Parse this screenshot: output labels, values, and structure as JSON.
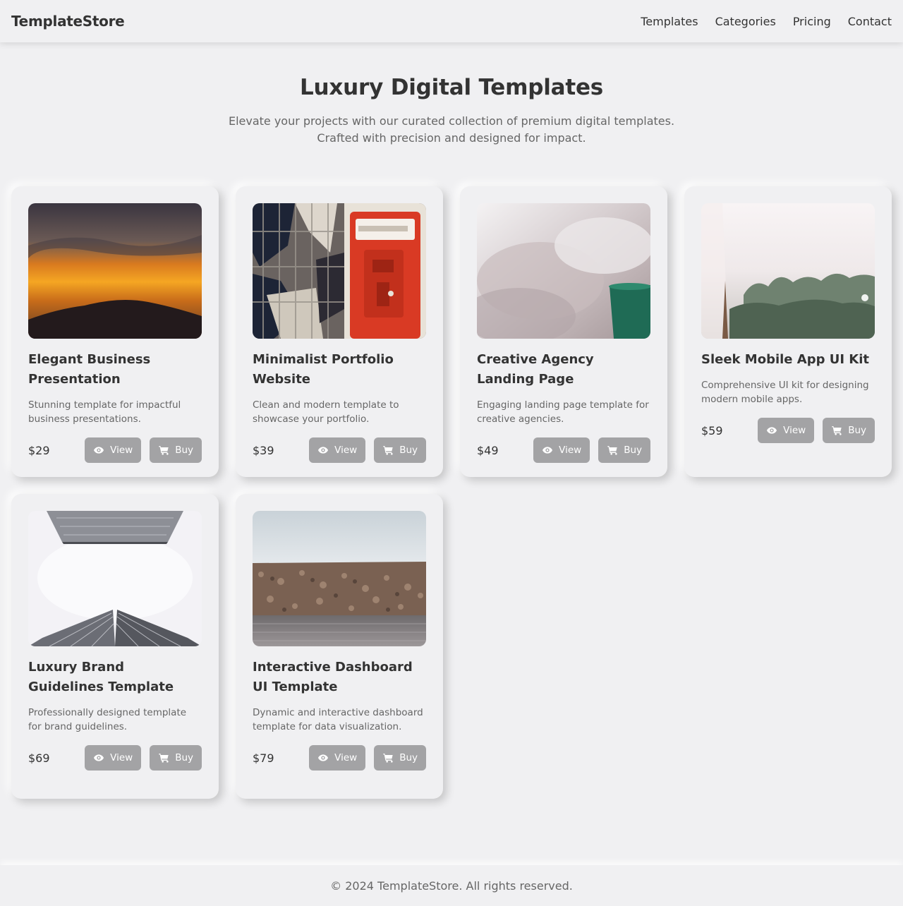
{
  "nav": {
    "brand": "TemplateStore",
    "links": [
      "Templates",
      "Categories",
      "Pricing",
      "Contact"
    ]
  },
  "hero": {
    "title": "Luxury Digital Templates",
    "subtitle_line1": "Elevate your projects with our curated collection of premium digital templates.",
    "subtitle_line2": "Crafted with precision and designed for impact."
  },
  "buttons": {
    "view": "View",
    "buy": "Buy"
  },
  "icons": {
    "view": "eye-icon",
    "buy": "cart-icon"
  },
  "templates": [
    {
      "title": "Elegant Business Presentation",
      "description": "Stunning template for impactful business presentations.",
      "price": "$29",
      "image": "sunset-mountain-silhouette"
    },
    {
      "title": "Minimalist Portfolio Website",
      "description": "Clean and modern template to showcase your portfolio.",
      "price": "$39",
      "image": "red-alarm-box"
    },
    {
      "title": "Creative Agency Landing Page",
      "description": "Engaging landing page template for creative agencies.",
      "price": "$49",
      "image": "steam-and-green-cup"
    },
    {
      "title": "Sleek Mobile App UI Kit",
      "description": "Comprehensive UI kit for designing modern mobile apps.",
      "price": "$59",
      "image": "hazy-trees"
    },
    {
      "title": "Luxury Brand Guidelines Template",
      "description": "Professionally designed template for brand guidelines.",
      "price": "$69",
      "image": "skyscrapers-from-below"
    },
    {
      "title": "Interactive Dashboard UI Template",
      "description": "Dynamic and interactive dashboard template for data visualization.",
      "price": "$79",
      "image": "rocky-shoreline"
    }
  ],
  "footer": {
    "text": "© 2024 TemplateStore. All rights reserved."
  }
}
